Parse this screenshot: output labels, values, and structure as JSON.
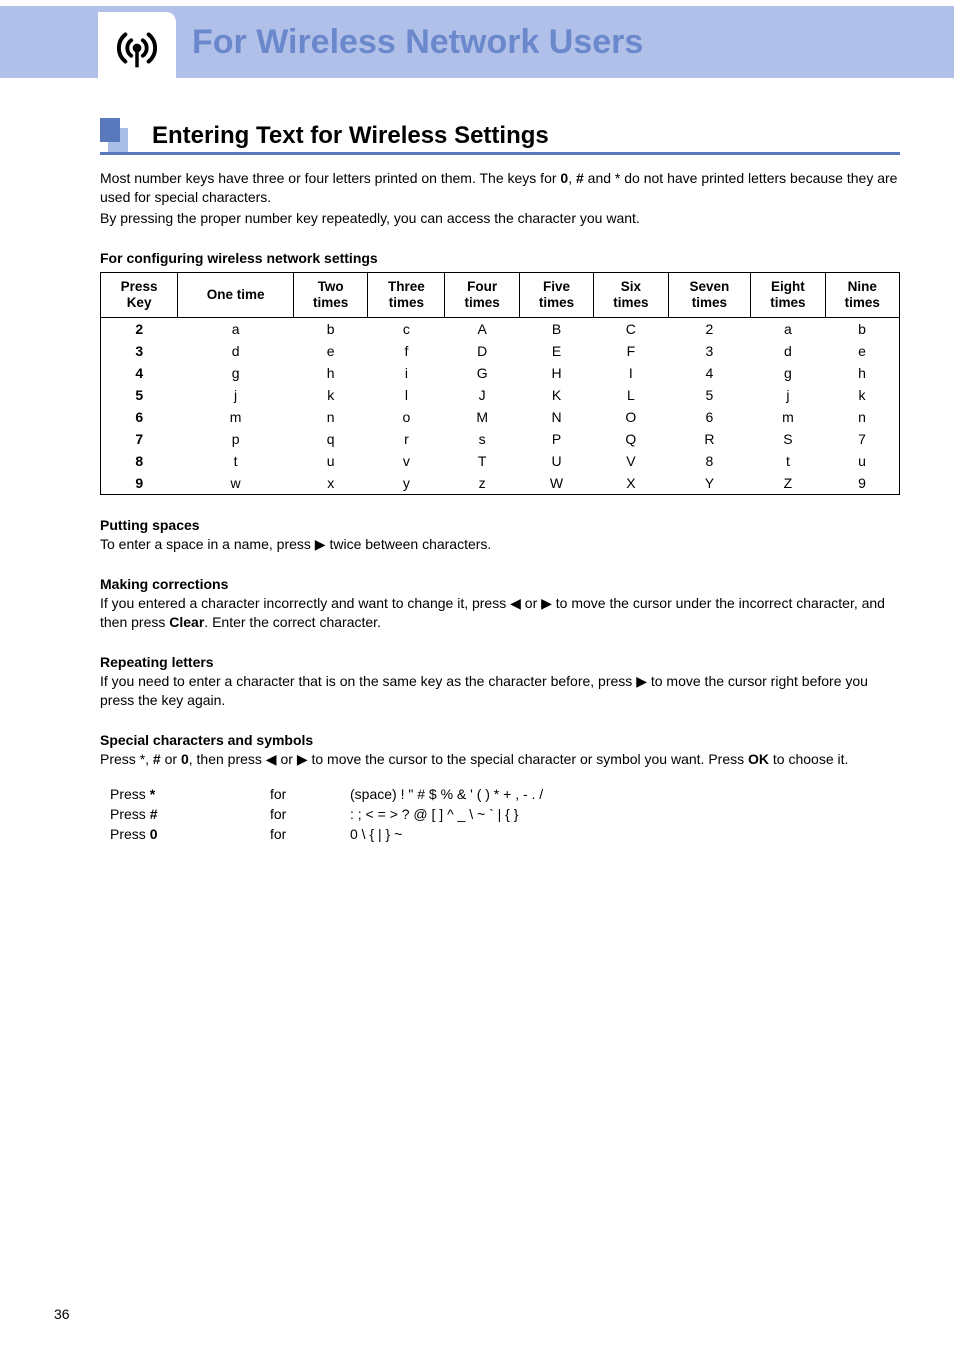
{
  "header": {
    "title": "For Wireless Network Users"
  },
  "section": {
    "title": "Entering Text for Wireless Settings"
  },
  "intro": {
    "l1a": "Most number keys have three or four letters printed on them. The keys for ",
    "l1b": "0",
    "l1c": ", ",
    "l1d": "#",
    "l1e": " and ",
    "l1f": "*",
    "l1g": " do not have printed letters because they are used for special characters.",
    "l2": "By pressing the proper number key repeatedly, you can access the character you want."
  },
  "tableCaption": "For configuring wireless network settings",
  "tableHead": [
    "Press Key",
    "One time",
    "Two times",
    "Three times",
    "Four times",
    "Five times",
    "Six times",
    "Seven times",
    "Eight times",
    "Nine times"
  ],
  "tableRows": [
    [
      "2",
      "a",
      "b",
      "c",
      "A",
      "B",
      "C",
      "2",
      "a",
      "b"
    ],
    [
      "3",
      "d",
      "e",
      "f",
      "D",
      "E",
      "F",
      "3",
      "d",
      "e"
    ],
    [
      "4",
      "g",
      "h",
      "i",
      "G",
      "H",
      "I",
      "4",
      "g",
      "h"
    ],
    [
      "5",
      "j",
      "k",
      "l",
      "J",
      "K",
      "L",
      "5",
      "j",
      "k"
    ],
    [
      "6",
      "m",
      "n",
      "o",
      "M",
      "N",
      "O",
      "6",
      "m",
      "n"
    ],
    [
      "7",
      "p",
      "q",
      "r",
      "s",
      "P",
      "Q",
      "R",
      "S",
      "7"
    ],
    [
      "8",
      "t",
      "u",
      "v",
      "T",
      "U",
      "V",
      "8",
      "t",
      "u"
    ],
    [
      "9",
      "w",
      "x",
      "y",
      "z",
      "W",
      "X",
      "Y",
      "Z",
      "9"
    ]
  ],
  "putting": {
    "head": "Putting spaces",
    "a": "To enter a space in a name, press ",
    "arrow": "▶",
    "b": " twice between characters."
  },
  "making": {
    "head": "Making corrections",
    "a": "If you entered a character incorrectly and want to change it, press ",
    "l": "◀",
    "or": " or ",
    "r": "▶",
    "b": " to move the cursor under the incorrect character, and then press ",
    "clear": "Clear",
    "c": ". Enter the correct character."
  },
  "repeating": {
    "head": "Repeating letters",
    "a": "If you need to enter a character that is on the same key as the character before, press ",
    "r": "▶",
    "b": " to move the cursor right before you press the key again."
  },
  "special": {
    "head": "Special characters and symbols",
    "a": "Press ",
    "star": "*",
    "c1": ", ",
    "hash": "#",
    "c2": " or ",
    "zero": "0",
    "b": ", then press ",
    "l": "◀",
    "or": " or ",
    "r": "▶",
    "c": " to move the cursor to the special character or symbol you want. Press ",
    "ok": "OK",
    "d": " to choose it."
  },
  "specRows": [
    {
      "label_a": "Press ",
      "label_b": "*",
      "for": "for",
      "chars": "(space) ! \" # $ % & ' ( ) * + , - . /"
    },
    {
      "label_a": "Press ",
      "label_b": "#",
      "for": "for",
      "chars": ": ; < = > ? @ [ ] ^ _ \\ ~ ` | { }"
    },
    {
      "label_a": "Press ",
      "label_b": "0",
      "for": "for",
      "chars": "0 \\ { | } ~"
    }
  ],
  "pageNum": "36"
}
